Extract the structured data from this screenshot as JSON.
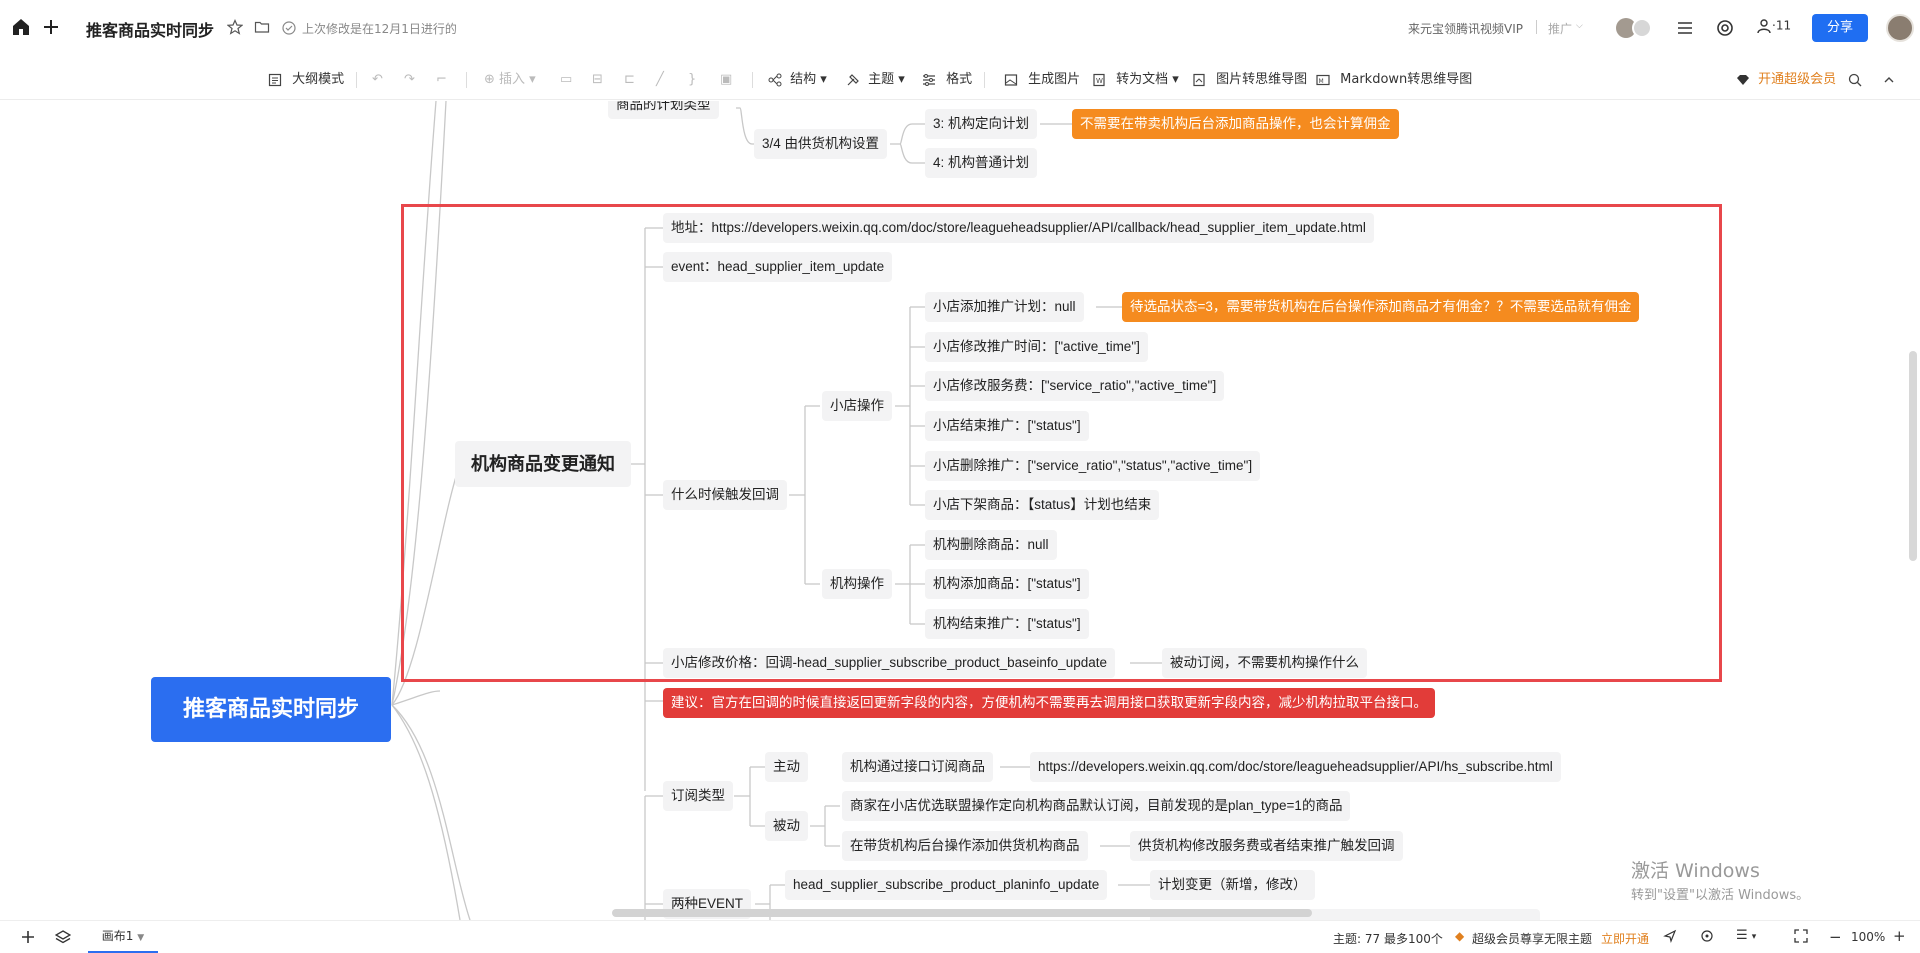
{
  "topbar": {
    "title": "推客商品实时同步",
    "last_modified": "上次修改是在12月1日进行的",
    "vip_text": "来元宝领腾讯视频VIP",
    "promo": "推广",
    "collab_count": "11",
    "share_label": "分享"
  },
  "toolbar": {
    "outline": "大纲模式",
    "insert": "插入",
    "structure": "结构",
    "theme": "主题",
    "format": "格式",
    "gen_image": "生成图片",
    "to_doc": "转为文档",
    "img_to_mindmap": "图片转思维导图",
    "md_to_mindmap": "Markdown转思维导图",
    "vip": "开通超级会员"
  },
  "mindmap": {
    "root": "推客商品实时同步",
    "plan_type": "商品的计划类型",
    "supplier_set": "3/4 由供货机构设置",
    "plan3": "3: 机构定向计划",
    "plan3_note": "不需要在带卖机构后台添加商品操作，也会计算佣金",
    "plan4": "4: 机构普通计划",
    "notify": "机构商品变更通知",
    "address": "地址：https://developers.weixin.qq.com/doc/store/leagueheadsupplier/API/callback/head_supplier_item_update.html",
    "event": "event：head_supplier_item_update",
    "when_trigger": "什么时候触发回调",
    "shop_ops": "小店操作",
    "shop_add": "小店添加推广计划：null",
    "shop_add_note": "待选品状态=3，需要带货机构在后台操作添加商品才有佣金？？不需要选品就有佣金",
    "shop_time": "小店修改推广时间：[\"active_time\"]",
    "shop_fee": "小店修改服务费：[\"service_ratio\",\"active_time\"]",
    "shop_end": "小店结束推广：[\"status\"]",
    "shop_del": "小店删除推广：[\"service_ratio\",\"status\",\"active_time\"]",
    "shop_offshelf": "小店下架商品：【status】计划也结束",
    "org_ops": "机构操作",
    "org_del": "机构删除商品：null",
    "org_add": "机构添加商品：[\"status\"]",
    "org_end": "机构结束推广：[\"status\"]",
    "price_change": "小店修改价格：回调-head_supplier_subscribe_product_baseinfo_update",
    "price_note": "被动订阅，不需要机构操作什么",
    "suggestion": "建议：官方在回调的时候直接返回更新字段的内容，方便机构不需要再去调用接口获取更新字段内容，减少机构拉取平台接口。",
    "sub_type": "订阅类型",
    "active": "主动",
    "active_item": "机构通过接口订阅商品",
    "active_url": "https://developers.weixin.qq.com/doc/store/leagueheadsupplier/API/hs_subscribe.html",
    "passive": "被动",
    "passive_item1": "商家在小店优选联盟操作定向机构商品默认订阅，目前发现的是plan_type=1的商品",
    "passive_item2": "在带货机构后台操作添加供货机构商品",
    "passive_item2_note": "供货机构修改服务费或者结束推广触发回调",
    "two_events": "两种EVENT",
    "event_planinfo": "head_supplier_subscribe_product_planinfo_update",
    "event_planinfo_note": "计划变更（新增，修改）"
  },
  "watermark": {
    "line1": "激活 Windows",
    "line2": "转到\"设置\"以激活 Windows。"
  },
  "bottombar": {
    "canvas_tab": "画布1",
    "topic_count": "主题: 77 最多100个",
    "vip_promo": "超级会员尊享无限主题",
    "open_now": "立即开通",
    "zoom": "100%"
  },
  "colors": {
    "accent": "#2b6ef0",
    "orange": "#f58b1f",
    "red": "#e23c39",
    "selection": "#e8474b"
  }
}
